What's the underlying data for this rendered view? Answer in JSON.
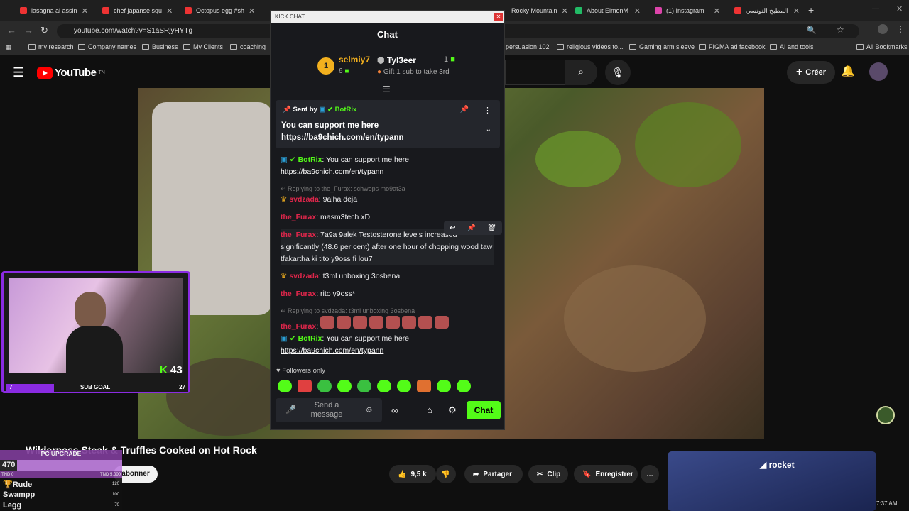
{
  "tabs": [
    {
      "label": "lasagna al assin",
      "color": "#e33"
    },
    {
      "label": "chef japanse squ",
      "color": "#e33"
    },
    {
      "label": "Octopus egg #sh",
      "color": "#e33"
    },
    {
      "label": "Rocky Mountain",
      "color": "#4a8"
    },
    {
      "label": "About EimonM",
      "color": "#2b6"
    },
    {
      "label": "(1) Instagram",
      "color": "#d4a"
    },
    {
      "label": "المطبخ التونسي",
      "color": "#e33"
    }
  ],
  "kick_tab": "KICK CHAT",
  "url": "youtube.com/watch?v=S1aSRjyHYTg",
  "bookmarks": [
    "my research",
    "Company names",
    "Business",
    "My Clients",
    "coaching",
    "persuasion 102",
    "religious videos to...",
    "Gaming arm sleeve",
    "FIGMA ad facebook",
    "AI and tools",
    "All Bookmarks"
  ],
  "yt": {
    "logo": "YouTube",
    "country": "TN",
    "create": "Créer"
  },
  "chat": {
    "title": "Chat",
    "top1": {
      "name": "selmiy7",
      "count": "6",
      "rank": "1"
    },
    "top2": {
      "name": "Tyl3eer",
      "count": "1"
    },
    "gift_text": "Gift 1 sub to take 3rd",
    "pinned_sent_by": "Sent by",
    "pinned_user": "BotRix",
    "pinned_msg": "You can support me here",
    "pinned_link": "https://ba9chich.com/en/typann",
    "messages": [
      {
        "user": "BotRix",
        "text": "You can support me here",
        "link": "https://ba9chich.com/en/typann"
      },
      {
        "reply": "Replying to the_Furax: schweps mo9at3a"
      },
      {
        "user": "svdzada",
        "text": "9alha deja"
      },
      {
        "user": "the_Furax",
        "text": "masm3tech xD"
      },
      {
        "user": "the_Furax",
        "text": "7a9a 9alek Testosterone levels increased significantly (48.6 per cent) after one hour of chopping wood taw tfakartha ki tito y9oss fi lou7"
      },
      {
        "user": "svdzada",
        "text": "t3ml unboxing 3osbena"
      },
      {
        "user": "the_Furax",
        "text": "rito y9oss*"
      },
      {
        "reply": "Replying to svdzada: t3ml unboxing 3osbena"
      },
      {
        "user": "the_Furax",
        "text": ""
      },
      {
        "user": "BotRix",
        "text": "You can support me here",
        "link": "https://ba9chich.com/en/typann"
      }
    ],
    "followers_only": "Followers only",
    "input_placeholder": "Send a message",
    "send_label": "Chat"
  },
  "webcam": {
    "sub_count": "43",
    "sub_goal": "SUB GOAL",
    "goal_left": "7",
    "goal_right": "27"
  },
  "video_title": "Wilderness Steak & Truffles Cooked on Hot Rock",
  "subscribe": "abonner",
  "likes": "9,5 k",
  "actions": {
    "share": "Partager",
    "clip": "Clip",
    "save": "Enregistrer"
  },
  "ad": {
    "brand": "rocket"
  },
  "overlay": {
    "pc_upgrade": "PC UPGRADE",
    "amount": "470",
    "tnd0": "TND 0",
    "tnd5000": "TND 5,000",
    "leaders": [
      {
        "name": "Rude",
        "value": "120"
      },
      {
        "name": "Swampp",
        "value": "100"
      },
      {
        "name": "Legg",
        "value": "70"
      }
    ]
  },
  "time": "7:37 AM"
}
